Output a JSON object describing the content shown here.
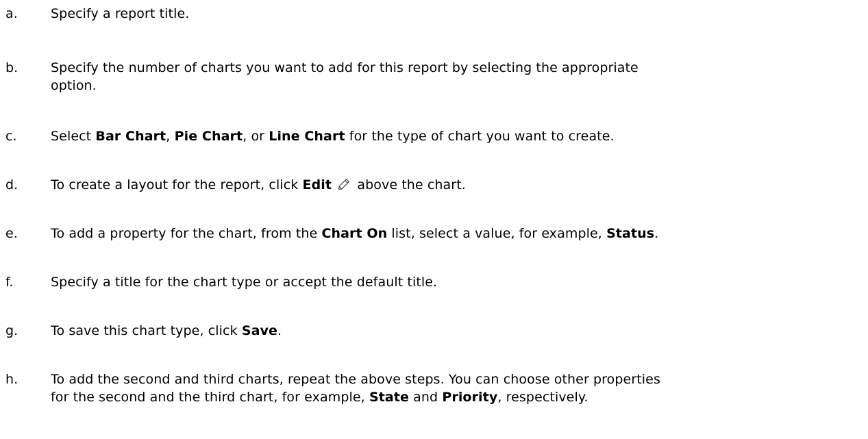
{
  "steps": [
    {
      "marker": "a.",
      "parts": [
        {
          "t": "Specify a report title."
        }
      ]
    },
    {
      "marker": "b.",
      "parts": [
        {
          "t": "Specify the number of charts you want to add for this report by selecting the appropriate"
        },
        {
          "br": true
        },
        {
          "t": "option."
        }
      ]
    },
    {
      "marker": "c.",
      "parts": [
        {
          "t": "Select "
        },
        {
          "t": "Bar Chart",
          "b": true
        },
        {
          "t": ", "
        },
        {
          "t": "Pie Chart",
          "b": true
        },
        {
          "t": ", or "
        },
        {
          "t": "Line Chart",
          "b": true
        },
        {
          "t": " for the type of chart you want to create."
        }
      ]
    },
    {
      "marker": "d.",
      "parts": [
        {
          "t": "To create a layout for the report, click "
        },
        {
          "t": "Edit",
          "b": true
        },
        {
          "t": " "
        },
        {
          "icon": "pencil-icon"
        },
        {
          "t": " above the chart."
        }
      ]
    },
    {
      "marker": "e.",
      "parts": [
        {
          "t": "To add a property for the chart, from the "
        },
        {
          "t": "Chart On",
          "b": true
        },
        {
          "t": " list, select a value, for example, "
        },
        {
          "t": "Status",
          "b": true
        },
        {
          "t": "."
        }
      ]
    },
    {
      "marker": "f.",
      "parts": [
        {
          "t": "Specify a title for the chart type or accept the default title."
        }
      ]
    },
    {
      "marker": "g.",
      "parts": [
        {
          "t": "To save this chart type, click "
        },
        {
          "t": "Save",
          "b": true
        },
        {
          "t": "."
        }
      ]
    },
    {
      "marker": "h.",
      "parts": [
        {
          "t": "To add the second and third charts, repeat the above steps. You can choose other properties"
        },
        {
          "br": true
        },
        {
          "t": "for the second and the third chart, for example, "
        },
        {
          "t": "State",
          "b": true
        },
        {
          "t": " and "
        },
        {
          "t": "Priority",
          "b": true
        },
        {
          "t": ", respectively."
        }
      ]
    }
  ]
}
